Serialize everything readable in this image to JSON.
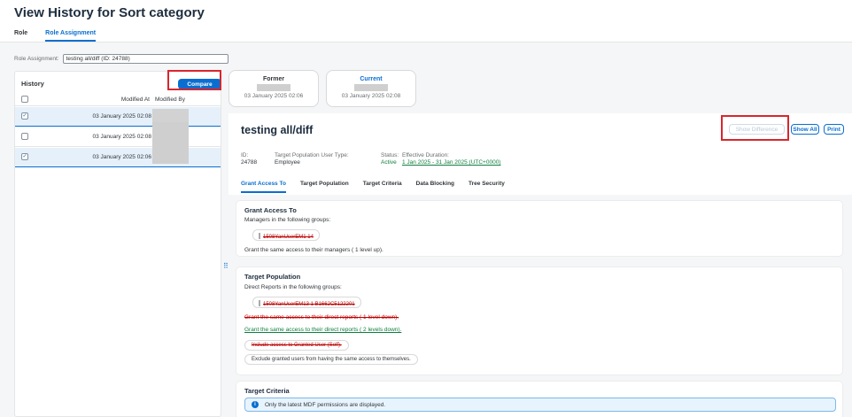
{
  "header": {
    "title": "View History for Sort category",
    "tabs": [
      {
        "label": "Role"
      },
      {
        "label": "Role Assignment"
      }
    ]
  },
  "role_assignment": {
    "label": "Role Assignment:",
    "value": "testing all/diff (ID: 24788)"
  },
  "history": {
    "title": "History",
    "compare_label": "Compare",
    "col_modified_at": "Modified At",
    "col_modified_by": "Modified By",
    "rows": [
      {
        "date": "03 January 2025 02:08",
        "checked": true
      },
      {
        "date": "03 January 2025 02:08",
        "checked": false
      },
      {
        "date": "03 January 2025 02:06",
        "checked": true
      }
    ],
    "checked_glyph": "✓"
  },
  "compare": {
    "former": {
      "title": "Former",
      "date": "03 January 2025 02:06"
    },
    "current": {
      "title": "Current",
      "date": "03 January 2025 02:08"
    }
  },
  "object": {
    "title": "testing all/diff",
    "show_difference": "Show Difference",
    "show_all": "Show All",
    "print": "Print",
    "id_label": "ID:",
    "id_value": "24788",
    "tpu_label": "Target Population User Type:",
    "tpu_value": "Employee",
    "status_label": "Status:",
    "status_value": "Active",
    "eff_label": "Effective Duration:",
    "eff_value": "1 Jan 2025 - 31 Jan 2025 (UTC+0000)",
    "tabs": [
      "Grant Access To",
      "Target Population",
      "Target Criteria",
      "Data Blocking",
      "Tree Security"
    ]
  },
  "grant_access": {
    "title": "Grant Access To",
    "subtitle": "Managers in the following groups:",
    "group": "1508YanUserEM1 14",
    "same_access": "Grant the same access to their managers ( 1  level up)."
  },
  "target_population": {
    "title": "Target Population",
    "subtitle": "Direct Reports in the following groups:",
    "group": "1508YanUserEM13 1 B1662C5122201",
    "old_direct": "Grant the same access to their direct reports ( 1  level down).",
    "new_direct": "Grant the same access to their direct reports ( 2  levels down).",
    "include_self": "Include access to Granted User (Self).",
    "exclude": "Exclude granted users from having the same access to themselves."
  },
  "target_criteria": {
    "title": "Target Criteria",
    "info": "Only the latest MDF permissions are displayed.",
    "info_glyph": "i"
  },
  "splitter_glyph": "⠿",
  "colors": {
    "accent": "#0a6ed1",
    "deleted": "#bb0000",
    "added": "#107e3e",
    "highlight_box": "#d9262c"
  }
}
